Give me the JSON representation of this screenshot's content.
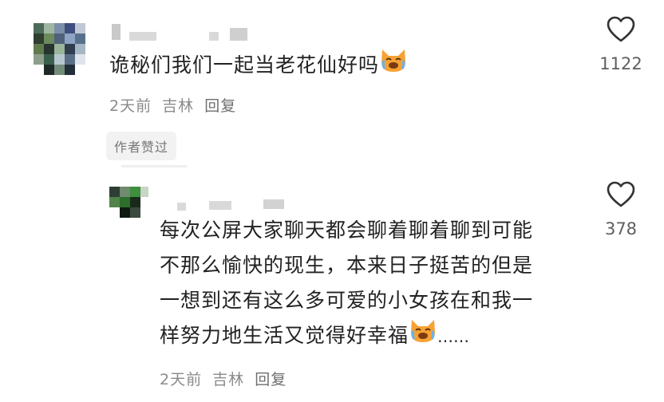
{
  "comments": [
    {
      "text": "诡秘们我们一起当老花仙好吗",
      "time": "2天前",
      "location": "吉林",
      "reply_label": "回复",
      "likes": "1122",
      "badge": "作者赞过"
    },
    {
      "lines": [
        "每次公屏大家聊天都会聊着聊着聊到可能",
        "不那么愉快的现生，本来日子挺苦的但是",
        "一想到还有这么多可爱的小女孩在和我一",
        "样努力地生活又觉得好幸福"
      ],
      "ellipsis": "……",
      "time": "2天前",
      "location": "吉林",
      "reply_label": "回复",
      "likes": "378"
    }
  ],
  "icons": [
    "heart-icon",
    "crying-cat-emoji"
  ],
  "colors": {
    "emoji_orange": "#f7a234",
    "meta_gray": "#8a8a8a"
  }
}
